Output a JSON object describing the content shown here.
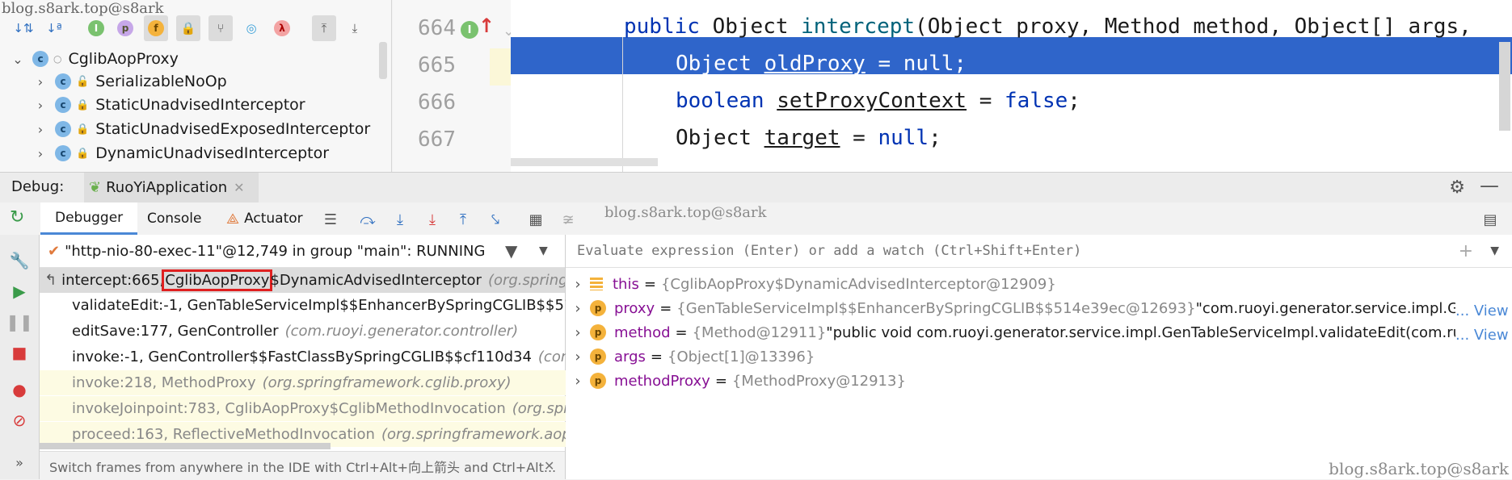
{
  "watermark": "blog.s8ark.top@s8ark",
  "structure": {
    "tree": [
      {
        "label": "CglibAopProxy",
        "badge": "c",
        "expanded": true
      },
      {
        "label": "SerializableNoOp",
        "badge": "c"
      },
      {
        "label": "StaticUnadvisedInterceptor",
        "badge": "c"
      },
      {
        "label": "StaticUnadvisedExposedInterceptor",
        "badge": "c"
      },
      {
        "label": "DynamicUnadvisedInterceptor",
        "badge": "c"
      }
    ]
  },
  "editor": {
    "lines": [
      "664",
      "665",
      "666",
      "667"
    ],
    "code": {
      "l664_kw": "public",
      "l664_type": " Object ",
      "l664_fn": "intercept",
      "l664_rest": "(Object proxy, Method method, Object[] args,",
      "l665_type": "Object ",
      "l665_var": "oldProxy",
      "l665_eq": " = ",
      "l665_val": "null",
      "l665_end": ";",
      "l666_kw": "boolean",
      "l666_var": "setProxyContext",
      "l666_eq": " = ",
      "l666_val": "false",
      "l666_end": ";",
      "l667_type": "Object ",
      "l667_var": "target",
      "l667_eq": " = ",
      "l667_val": "null",
      "l667_end": ";"
    }
  },
  "debug": {
    "label": "Debug:",
    "session": "RuoYiApplication",
    "tabs": [
      "Debugger",
      "Console",
      "Actuator"
    ],
    "thread": "\"http-nio-80-exec-11\"@12,749 in group \"main\": RUNNING",
    "eval_placeholder": "Evaluate expression (Enter) or add a watch (Ctrl+Shift+Enter)",
    "frames": [
      {
        "text": "intercept:665, ",
        "highlight": "CglibAopProxy",
        "rest": "$DynamicAdvisedInterceptor",
        "pkg": "(org.spring"
      },
      {
        "text": "validateEdit:-1, GenTableServiceImpl$$EnhancerBySpringCGLIB$$514e",
        "pkg": ""
      },
      {
        "text": "editSave:177, GenController",
        "pkg": "(com.ruoyi.generator.controller)"
      },
      {
        "text": "invoke:-1, GenController$$FastClassBySpringCGLIB$$cf110d34",
        "pkg": "(com.ru"
      },
      {
        "text": "invoke:218, MethodProxy",
        "pkg": "(org.springframework.cglib.proxy)"
      },
      {
        "text": "invokeJoinpoint:783, CglibAopProxy$CglibMethodInvocation",
        "pkg": "(org.spri"
      },
      {
        "text": "proceed:163, ReflectiveMethodInvocation",
        "pkg": "(org.springframework.aop.fra"
      }
    ],
    "hint": "Switch frames from anywhere in the IDE with Ctrl+Alt+向上箭头 and Ctrl+Alt...",
    "variables": [
      {
        "badge": "",
        "name": "this",
        "value": "{CglibAopProxy$DynamicAdvisedInterceptor@12909}",
        "extra": ""
      },
      {
        "badge": "p",
        "name": "proxy",
        "value": "{GenTableServiceImpl$$EnhancerBySpringCGLIB$$514e39ec@12693}",
        "extra": " \"com.ruoyi.generator.service.impl.GenTabl",
        "link": "... View"
      },
      {
        "badge": "p",
        "name": "method",
        "value": "{Method@12911}",
        "extra": " \"public void com.ruoyi.generator.service.impl.GenTableServiceImpl.validateEdit(com.ruoyi.g",
        "link": "... View"
      },
      {
        "badge": "p",
        "name": "args",
        "value": "{Object[1]@13396}",
        "extra": ""
      },
      {
        "badge": "p",
        "name": "methodProxy",
        "value": "{MethodProxy@12913}",
        "extra": ""
      }
    ]
  }
}
